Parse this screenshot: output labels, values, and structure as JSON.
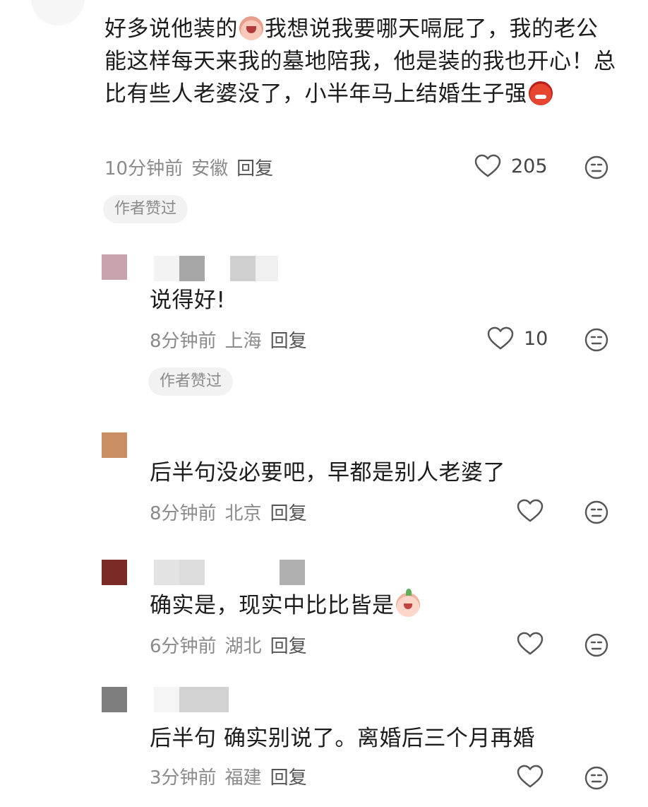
{
  "main_comment": {
    "text_part1": "好多说他装的",
    "text_part2": "我想说我要哪天嗝屁了，我的老公能这样每天来我的墓地陪我，他是装的我也开心！总比有些人老婆没了，小半年马上结婚生子强",
    "time": "10分钟前",
    "location": "安徽",
    "reply_label": "回复",
    "likes": "205",
    "badge": "作者赞过"
  },
  "replies": [
    {
      "text": "说得好!",
      "time": "8分钟前",
      "location": "上海",
      "reply_label": "回复",
      "likes": "10",
      "badge": "作者赞过",
      "avatar_color": "#c9a3ab"
    },
    {
      "text": "后半句没必要吧，早都是别人老婆了",
      "time": "8分钟前",
      "location": "北京",
      "reply_label": "回复",
      "likes": "",
      "avatar_color": "#c98e63"
    },
    {
      "text": "确实是，现实中比比皆是",
      "time": "6分钟前",
      "location": "湖北",
      "reply_label": "回复",
      "likes": "",
      "avatar_color": "#7a2b25"
    },
    {
      "text": "后半句 确实别说了。离婚后三个月再婚",
      "time": "3分钟前",
      "location": "福建",
      "reply_label": "回复",
      "likes": "",
      "avatar_color": "#7d7d7d"
    }
  ],
  "icons": {
    "like": "heart-outline-icon",
    "dislike": "neutral-face-icon",
    "emoji_1": "crying-face-emoji",
    "emoji_2": "angry-devil-emoji",
    "emoji_3": "crying-sprout-emoji"
  },
  "colors": {
    "text": "#1c1c1c",
    "meta": "#8a8a8a",
    "badge_bg": "#f2f2f2"
  }
}
